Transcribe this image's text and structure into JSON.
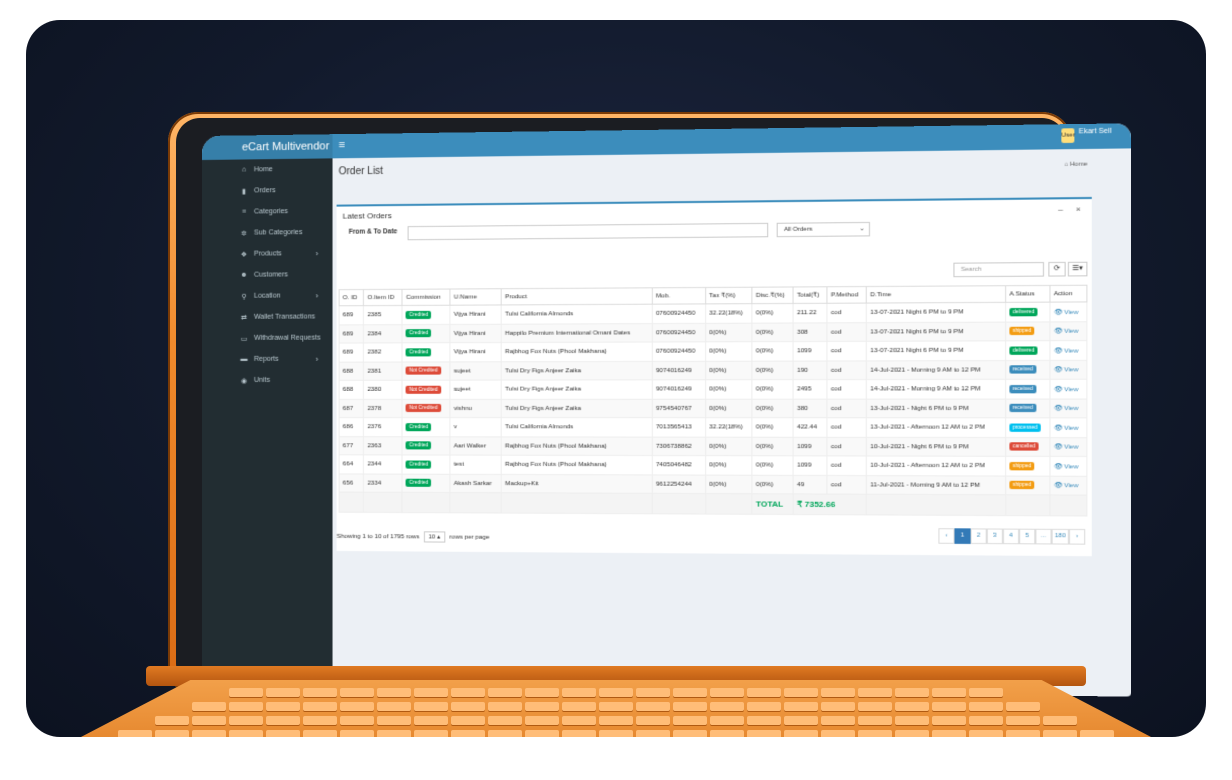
{
  "app": {
    "brand": "eCart Multivendor",
    "menu_icon": "≡",
    "user_label": "User",
    "user_name": "Ekart Sell"
  },
  "sidebar": {
    "items": [
      {
        "label": "Home",
        "icon": "home-icon",
        "glyph": "⌂"
      },
      {
        "label": "Orders",
        "icon": "cart-icon",
        "glyph": "▮"
      },
      {
        "label": "Categories",
        "icon": "sliders-icon",
        "glyph": "≡"
      },
      {
        "label": "Sub Categories",
        "icon": "gear-icon",
        "glyph": "✲"
      },
      {
        "label": "Products",
        "icon": "cubes-icon",
        "glyph": "❖",
        "arrow": "›"
      },
      {
        "label": "Customers",
        "icon": "users-icon",
        "glyph": "☻"
      },
      {
        "label": "Location",
        "icon": "map-pin-icon",
        "glyph": "⚲",
        "arrow": "›"
      },
      {
        "label": "Wallet Transactions",
        "icon": "exchange-icon",
        "glyph": "⇄"
      },
      {
        "label": "Withdrawal Requests",
        "icon": "card-icon",
        "glyph": "▭"
      },
      {
        "label": "Reports",
        "icon": "folder-icon",
        "glyph": "▬",
        "arrow": "›"
      },
      {
        "label": "Units",
        "icon": "circle-icon",
        "glyph": "◉"
      }
    ]
  },
  "page": {
    "title": "Order List",
    "breadcrumb": "Home",
    "breadcrumb_icon": "⌂"
  },
  "box": {
    "title": "Latest Orders",
    "minimize": "–",
    "close": "×",
    "filter_label": "From & To Date",
    "date_value": "",
    "status_select": "All Orders",
    "search_placeholder": "Search",
    "refresh_icon": "⟳",
    "columns_icon": "☰▾"
  },
  "table": {
    "headers": [
      "O. ID",
      "O.Item ID",
      "Commission",
      "U.Name",
      "Product",
      "Mob.",
      "Tax ₹(%)",
      "Disc.₹(%)",
      "Total(₹)",
      "P.Method",
      "D.Time",
      "A.Status",
      "Action"
    ],
    "rows": [
      {
        "oid": "689",
        "item": "2385",
        "comm": "Credited",
        "user": "Vijya Hirani",
        "product": "Tulsi California Almonds",
        "mob": "07600924450",
        "tax": "32.22(18%)",
        "disc": "0(0%)",
        "total": "211.22",
        "pm": "cod",
        "dtime": "13-07-2021 Night 6 PM to 9 PM",
        "status": "delivered",
        "action": "View"
      },
      {
        "oid": "689",
        "item": "2384",
        "comm": "Credited",
        "user": "Vijya Hirani",
        "product": "Happilo Premium International Omani Dates",
        "mob": "07600924450",
        "tax": "0(0%)",
        "disc": "0(0%)",
        "total": "308",
        "pm": "cod",
        "dtime": "13-07-2021 Night 6 PM to 9 PM",
        "status": "shipped",
        "action": "View"
      },
      {
        "oid": "689",
        "item": "2382",
        "comm": "Credited",
        "user": "Vijya Hirani",
        "product": "Rajbhog Fox Nuts (Phool Makhana)",
        "mob": "07600924450",
        "tax": "0(0%)",
        "disc": "0(0%)",
        "total": "1099",
        "pm": "cod",
        "dtime": "13-07-2021 Night 6 PM to 9 PM",
        "status": "delivered",
        "action": "View"
      },
      {
        "oid": "688",
        "item": "2381",
        "comm": "Not Credited",
        "user": "sujeet",
        "product": "Tulsi Dry Figs Anjeer Zaika",
        "mob": "9074016249",
        "tax": "0(0%)",
        "disc": "0(0%)",
        "total": "190",
        "pm": "cod",
        "dtime": "14-Jul-2021 - Morning 9 AM to 12 PM",
        "status": "received",
        "action": "View"
      },
      {
        "oid": "688",
        "item": "2380",
        "comm": "Not Credited",
        "user": "sujeet",
        "product": "Tulsi Dry Figs Anjeer Zaika",
        "mob": "9074016249",
        "tax": "0(0%)",
        "disc": "0(0%)",
        "total": "2495",
        "pm": "cod",
        "dtime": "14-Jul-2021 - Morning 9 AM to 12 PM",
        "status": "received",
        "action": "View"
      },
      {
        "oid": "687",
        "item": "2378",
        "comm": "Not Credited",
        "user": "vishnu",
        "product": "Tulsi Dry Figs Anjeer Zaika",
        "mob": "9754540767",
        "tax": "0(0%)",
        "disc": "0(0%)",
        "total": "380",
        "pm": "cod",
        "dtime": "13-Jul-2021 - Night 6 PM to 9 PM",
        "status": "received",
        "action": "View"
      },
      {
        "oid": "686",
        "item": "2376",
        "comm": "Credited",
        "user": "v",
        "product": "Tulsi California Almonds",
        "mob": "7013565413",
        "tax": "32.22(18%)",
        "disc": "0(0%)",
        "total": "422.44",
        "pm": "cod",
        "dtime": "13-Jul-2021 - Afternoon 12 AM to 2 PM",
        "status": "processed",
        "action": "View"
      },
      {
        "oid": "677",
        "item": "2363",
        "comm": "Credited",
        "user": "Aari Walker",
        "product": "Rajbhog Fox Nuts (Phool Makhana)",
        "mob": "7306738862",
        "tax": "0(0%)",
        "disc": "0(0%)",
        "total": "1099",
        "pm": "cod",
        "dtime": "10-Jul-2021 - Night 6 PM to 9 PM",
        "status": "cancelled",
        "action": "View"
      },
      {
        "oid": "664",
        "item": "2344",
        "comm": "Credited",
        "user": "test",
        "product": "Rajbhog Fox Nuts (Phool Makhana)",
        "mob": "7405046482",
        "tax": "0(0%)",
        "disc": "0(0%)",
        "total": "1099",
        "pm": "cod",
        "dtime": "10-Jul-2021 - Afternoon 12 AM to 2 PM",
        "status": "shipped",
        "action": "View"
      },
      {
        "oid": "656",
        "item": "2334",
        "comm": "Credited",
        "user": "Akash Sarkar",
        "product": "Mackup+Kit",
        "mob": "9612254244",
        "tax": "0(0%)",
        "disc": "0(0%)",
        "total": "49",
        "pm": "cod",
        "dtime": "11-Jul-2021 - Morning 9 AM to 12 PM",
        "status": "shipped",
        "action": "View"
      }
    ],
    "total_label": "TOTAL",
    "total_value": "₹ 7352.66"
  },
  "footer": {
    "showing": "Showing 1 to 10 of 1795 rows",
    "rows_per_page": "10",
    "rows_per_page_suffix": "rows per page",
    "pages": [
      "‹",
      "1",
      "2",
      "3",
      "4",
      "5",
      "...",
      "180",
      "›"
    ],
    "active_page": "1"
  },
  "colors": {
    "header_blue": "#3c8dbc",
    "sidebar_dark": "#222d32",
    "credited": "#00a65a",
    "not_credited": "#dd4b39",
    "delivered": "#00a65a",
    "shipped": "#f39c12",
    "received": "#3c8dbc",
    "processed": "#00c0ef",
    "cancelled": "#dd4b39",
    "laptop_orange": "#f08a2c"
  }
}
